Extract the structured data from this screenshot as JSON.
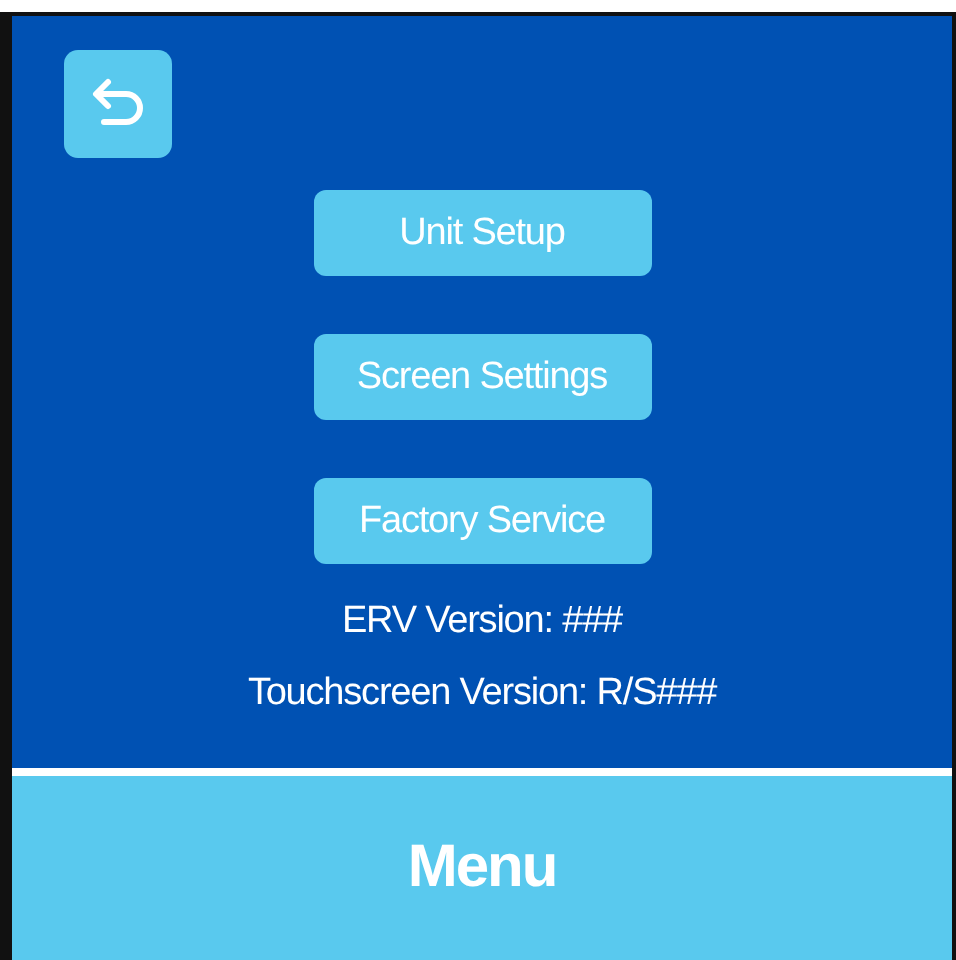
{
  "menu_buttons": [
    {
      "label": "Unit Setup"
    },
    {
      "label": "Screen Settings"
    },
    {
      "label": "Factory Service"
    }
  ],
  "versions": [
    "ERV Version: ###",
    "Touchscreen Version: R/S###"
  ],
  "footer": {
    "title": "Menu"
  }
}
